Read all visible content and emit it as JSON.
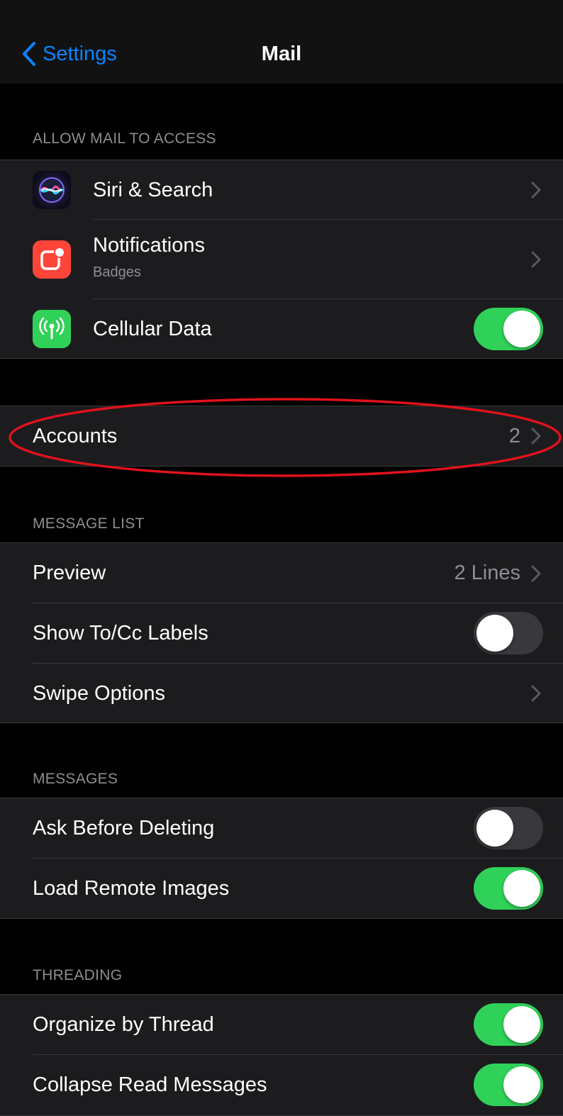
{
  "nav": {
    "back_label": "Settings",
    "title": "Mail"
  },
  "sections": {
    "allow_access": {
      "header": "ALLOW MAIL TO ACCESS",
      "siri": {
        "label": "Siri & Search"
      },
      "notifications": {
        "label": "Notifications",
        "subtitle": "Badges"
      },
      "cellular": {
        "label": "Cellular Data",
        "toggle": "on"
      }
    },
    "accounts": {
      "label": "Accounts",
      "value": "2"
    },
    "message_list": {
      "header": "MESSAGE LIST",
      "preview": {
        "label": "Preview",
        "value": "2 Lines"
      },
      "show_to_cc": {
        "label": "Show To/Cc Labels",
        "toggle": "off"
      },
      "swipe": {
        "label": "Swipe Options"
      }
    },
    "messages": {
      "header": "MESSAGES",
      "ask_before_deleting": {
        "label": "Ask Before Deleting",
        "toggle": "off"
      },
      "load_remote_images": {
        "label": "Load Remote Images",
        "toggle": "on"
      }
    },
    "threading": {
      "header": "THREADING",
      "organize_by_thread": {
        "label": "Organize by Thread",
        "toggle": "on"
      },
      "collapse_read": {
        "label": "Collapse Read Messages",
        "toggle": "on"
      }
    }
  },
  "colors": {
    "accent": "#0a84ff",
    "toggle_on": "#30d158",
    "toggle_off": "#39393d",
    "annotation": "#e0121c"
  },
  "icons": {
    "siri": "siri-icon",
    "notifications": "notifications-icon",
    "cellular": "cellular-antenna-icon"
  }
}
